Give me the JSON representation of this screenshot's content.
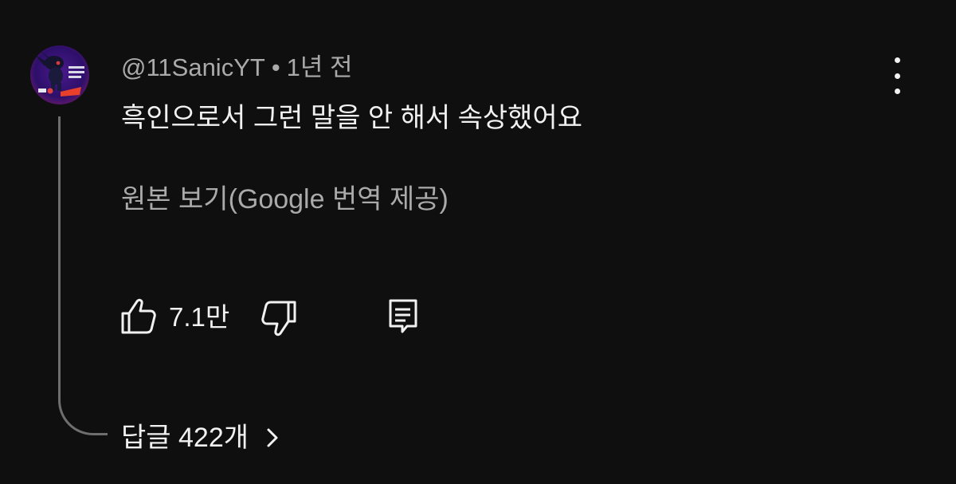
{
  "comment": {
    "author": "@11SanicYT",
    "separator": "•",
    "timestamp": "1년 전",
    "text": "흑인으로서 그런 말을 안 해서 속상했어요",
    "translate_link": "원본 보기(Google 번역 제공)",
    "like_count": "7.1만",
    "replies_label": "답글 422개"
  },
  "icons": {
    "like": "thumbs-up-icon",
    "dislike": "thumbs-down-icon",
    "reply": "comment-reply-icon",
    "more": "more-vertical-icon",
    "replies": "chevron-right-icon"
  },
  "colors": {
    "background": "#0f0f0f",
    "primary_text": "#f1f1f1",
    "secondary_text": "#aaaaaa"
  }
}
